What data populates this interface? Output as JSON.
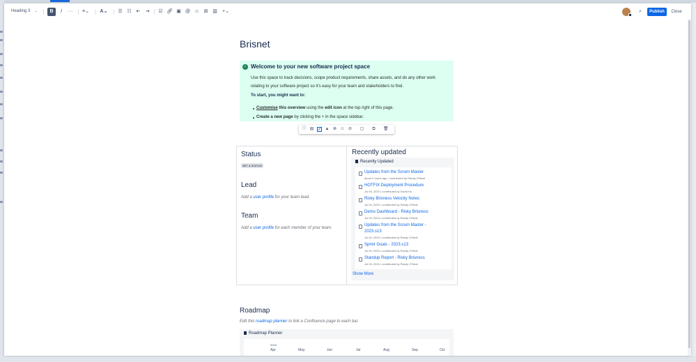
{
  "toolbar": {
    "text_style": "Heading 3",
    "bold": "B",
    "italic": "I",
    "more": "···",
    "publish": "Publish",
    "close": "Close",
    "icons": [
      "align-icon",
      "text-color-icon",
      "bullet-list-icon",
      "numbered-list-icon",
      "outdent-icon",
      "indent-icon",
      "task-icon",
      "link-icon",
      "image-icon",
      "mention-icon",
      "emoji-icon",
      "table-icon",
      "layout-icon",
      "insert-plus-icon",
      "search-icon"
    ]
  },
  "page": {
    "title": "Brisnet"
  },
  "panel": {
    "heading": "Welcome to your new software project space",
    "paragraph": "Use this space to track decisions, scope product requirements, share assets, and do any other work relating to your software project so it’s easy for your team and stakeholders to find.",
    "subheading": "To start, you might want to:",
    "item1_link": "Customise",
    "item1_b": "this overview",
    "item1_text": "using the",
    "item1_bold2": "edit icon",
    "item1_tail": "at the top right of this page.",
    "item2_b": "Create a new page",
    "item2_text": "by clicking the + in the space sidebar."
  },
  "layout": {
    "status_heading": "Status",
    "status_lozenge": "SET A STATUS",
    "lead_heading": "Lead",
    "lead_pre": "Add a",
    "lead_link": "user profile",
    "lead_post": "for your team lead.",
    "team_heading": "Team",
    "team_pre": "Add a",
    "team_link": "user profile",
    "team_post": "for each member of your team.",
    "recent_heading": "Recently updated",
    "recent_box_title": "Recently Updated",
    "show_more": "Show More",
    "items": [
      {
        "title": "Updates from the Scrum Master",
        "meta": "about 2 hours ago • contributed by Randy O'Neal"
      },
      {
        "title": "HOTFIX Deployment Procedure",
        "meta": "Jul 05, 2023 • contributed by David Ho"
      },
      {
        "title": "Risky Brisness Velocity Notes",
        "meta": "Jul 04, 2023 • contributed by Randy O'Neal"
      },
      {
        "title": "Demo Dashboard - Risky Brisness",
        "meta": "Jul 04, 2023 • contributed by Randy O'Neal"
      },
      {
        "title": "Updates from the Scrum Master -",
        "title2": "2023.s13",
        "meta": "Jul 04, 2023 • contributed by Randy O'Neal"
      },
      {
        "title": "Sprint Goals - 2023.s13",
        "meta": "Jul 04, 2023 • contributed by Randy O'Neal"
      },
      {
        "title": "Standup Report - Risky Brisness",
        "meta": "Jul 04, 2023 • contributed by Randy O'Neal"
      }
    ]
  },
  "roadmap": {
    "heading": "Roadmap",
    "pre": "Edit this",
    "link": "roadmap planner",
    "post": "to link a Confluence page to each bar.",
    "box_title": "Roadmap Planner",
    "year": "2016",
    "months": [
      "Apr",
      "May",
      "Jun",
      "Jul",
      "Aug",
      "Sep",
      "Oct"
    ]
  }
}
